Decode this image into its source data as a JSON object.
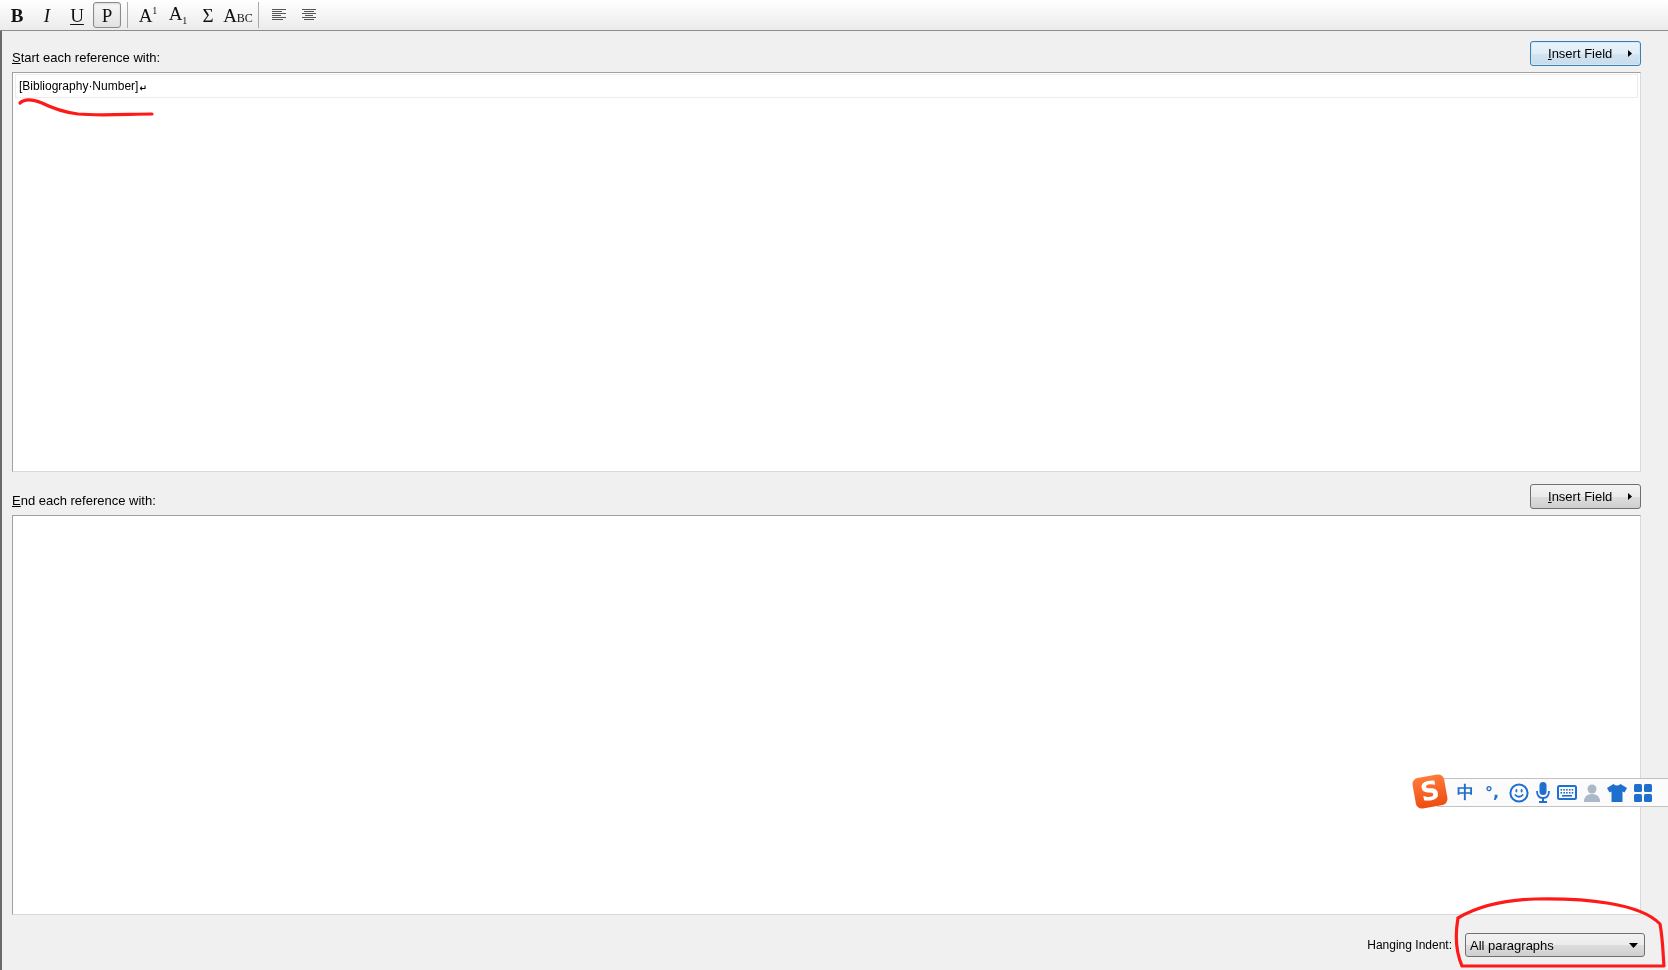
{
  "toolbar": {
    "groups": [
      [
        {
          "kind": "bold",
          "label": "B",
          "selected": false
        },
        {
          "kind": "italic",
          "label": "I",
          "selected": false
        },
        {
          "kind": "underline",
          "label": "U",
          "selected": false
        },
        {
          "kind": "plain",
          "label": "P",
          "selected": true
        }
      ],
      [
        {
          "kind": "superscript",
          "label": "A$^{1}$",
          "selected": false
        },
        {
          "kind": "subscript",
          "label": "A$_{1}$",
          "selected": false
        },
        {
          "kind": "symbol",
          "label": "Σ",
          "selected": false
        },
        {
          "kind": "smallcaps",
          "label": "ABC",
          "selected": false
        }
      ]
    ],
    "alignment": [
      {
        "kind": "left",
        "selected": false
      },
      {
        "kind": "center",
        "selected": false
      }
    ]
  },
  "start_section": {
    "label": "Start each reference with:",
    "insert_button": {
      "label": "Insert Field",
      "focused": true
    },
    "text": "[Bibliography·Number]",
    "paragraph_mark": "↵"
  },
  "end_section": {
    "label": "End each reference with:",
    "insert_button": {
      "label": "Insert Field",
      "focused": false
    }
  },
  "hanging_indent": {
    "label": "Hanging Indent:",
    "value": "All paragraphs"
  },
  "ime_toolbar": {
    "logo": "S",
    "language": "中",
    "punctuation": "°,"
  }
}
